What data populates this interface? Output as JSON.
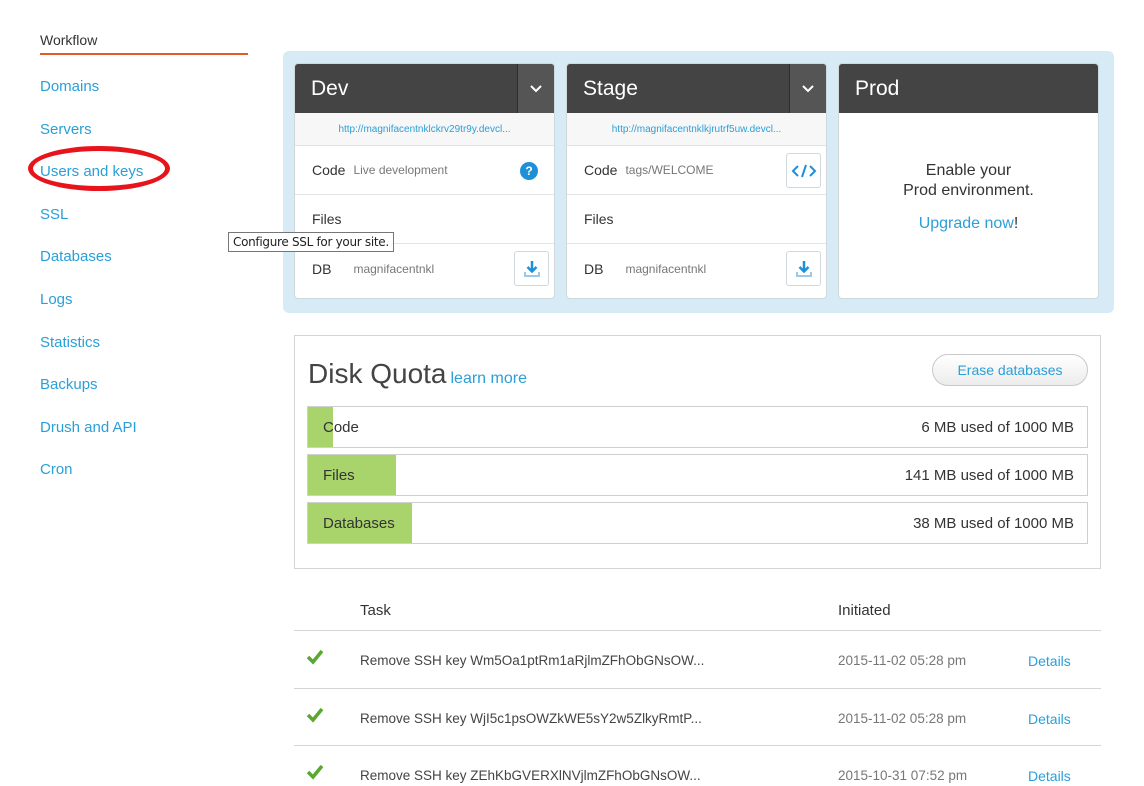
{
  "sidebar": {
    "active": "Workflow",
    "items": [
      {
        "label": "Domains"
      },
      {
        "label": "Servers"
      },
      {
        "label": "Users and keys"
      },
      {
        "label": "SSL"
      },
      {
        "label": "Databases"
      },
      {
        "label": "Logs"
      },
      {
        "label": "Statistics"
      },
      {
        "label": "Backups"
      },
      {
        "label": "Drush and API"
      },
      {
        "label": "Cron"
      }
    ],
    "tooltip": "Configure SSL for your site."
  },
  "environments": {
    "dev": {
      "title": "Dev",
      "url": "http://magnifacentnklckrv29tr9y.devcl...",
      "code_key": "Code",
      "code_value": "Live development",
      "files_key": "Files",
      "db_key": "DB",
      "db_value": "magnifacentnkl"
    },
    "stage": {
      "title": "Stage",
      "url": "http://magnifacentnklkjrutrf5uw.devcl...",
      "code_key": "Code",
      "code_value": "tags/WELCOME",
      "files_key": "Files",
      "db_key": "DB",
      "db_value": "magnifacentnkl"
    },
    "prod": {
      "title": "Prod",
      "line1": "Enable your",
      "line2": "Prod environment.",
      "upgrade_link": "Upgrade now",
      "upgrade_suffix": "!"
    }
  },
  "quota": {
    "title": "Disk Quota",
    "learn_more": "learn more",
    "erase_button": "Erase databases",
    "bars": [
      {
        "label": "Code",
        "used": "6 MB used of 1000 MB",
        "fraction": 0.006
      },
      {
        "label": "Files",
        "used": "141 MB used of 1000 MB",
        "fraction": 0.141
      },
      {
        "label": "Databases",
        "used": "38 MB used of 1000 MB",
        "fraction": 0.038
      }
    ]
  },
  "tasks": {
    "header_task": "Task",
    "header_initiated": "Initiated",
    "rows": [
      {
        "name": "Remove SSH key Wm5Oa1ptRm1aRjlmZFhObGNsOW...",
        "date": "2015-11-02 05:28 pm",
        "details": "Details"
      },
      {
        "name": "Remove SSH key WjI5c1psOWZkWE5sY2w5ZlkyRmtP...",
        "date": "2015-11-02 05:28 pm",
        "details": "Details"
      },
      {
        "name": "Remove SSH key ZEhKbGVERXlNVjlmZFhObGNsOW...",
        "date": "2015-10-31 07:52 pm",
        "details": "Details"
      }
    ]
  },
  "colors": {
    "link": "#2a9fd8",
    "accent_underline": "#e05a2b",
    "highlight_oval": "#e8141c",
    "quota_fill": "#a9d46b",
    "check": "#5aa832",
    "env_header": "#444444",
    "panel_bg": "#d7ebf6"
  },
  "icons": {
    "caret": "chevron-down-icon",
    "help": "question-icon",
    "code": "code-icon",
    "download": "download-icon",
    "check": "checkmark-icon"
  }
}
